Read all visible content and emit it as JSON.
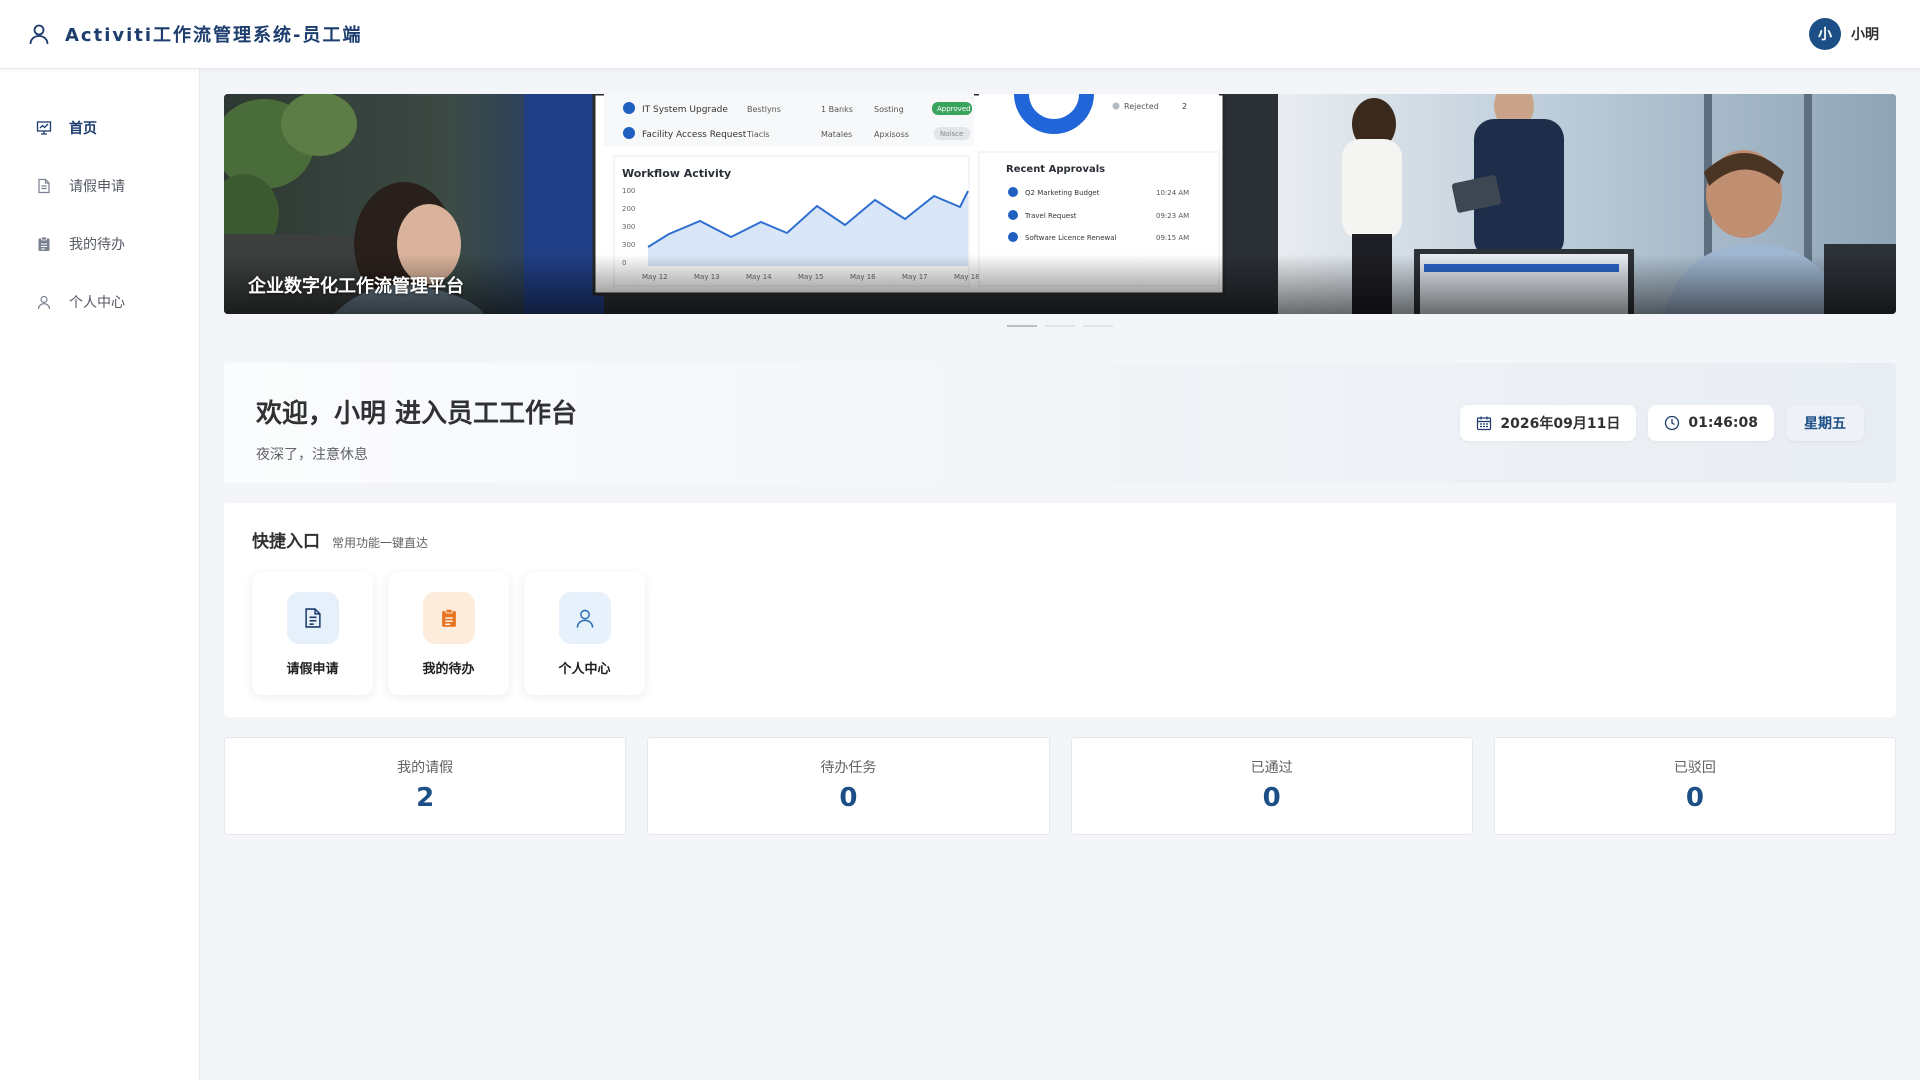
{
  "app": {
    "title": "Activiti工作流管理系统-员工端"
  },
  "user": {
    "avatar_text": "小",
    "name": "小明"
  },
  "sidebar": {
    "items": [
      {
        "label": "首页",
        "icon": "dashboard-icon",
        "active": true
      },
      {
        "label": "请假申请",
        "icon": "document-icon",
        "active": false
      },
      {
        "label": "我的待办",
        "icon": "clipboard-icon",
        "active": false
      },
      {
        "label": "个人中心",
        "icon": "user-icon",
        "active": false
      }
    ]
  },
  "banner": {
    "caption": "企业数字化工作流管理平台",
    "slide_count": 3,
    "active_slide": 1,
    "monitor": {
      "rows": [
        {
          "name": "IT System Upgrade",
          "c2": "Bestlyns",
          "c3": "1 Banks",
          "c4": "Sosting",
          "status": "Approved"
        },
        {
          "name": "Facility Access Request",
          "c2": "Tiacls",
          "c3": "Matales",
          "c4": "Apxisoss",
          "status": "Noisce"
        }
      ],
      "rejected_label": "Rejected",
      "rejected_count": "2",
      "chart_title": "Workflow Activity",
      "y_ticks": [
        "100",
        "200",
        "300",
        "300",
        "0"
      ],
      "x_ticks": [
        "May 12",
        "May 13",
        "May 14",
        "May 15",
        "May 16",
        "May 17",
        "May 18"
      ],
      "approvals_title": "Recent Approvals",
      "approvals": [
        {
          "name": "Q2 Marketing Budget",
          "time": "10:24 AM"
        },
        {
          "name": "Travel Request",
          "time": "09:23 AM"
        },
        {
          "name": "Software Licence Renewal",
          "time": "09:15 AM"
        }
      ]
    }
  },
  "welcome": {
    "title": "欢迎，小明 进入员工工作台",
    "subtitle": "夜深了，注意休息",
    "date": "2026年09月11日",
    "time": "01:46:08",
    "weekday": "星期五"
  },
  "quick": {
    "title": "快捷入口",
    "subtitle": "常用功能一键直达",
    "items": [
      {
        "label": "请假申请",
        "icon": "document-icon"
      },
      {
        "label": "我的待办",
        "icon": "clipboard-icon"
      },
      {
        "label": "个人中心",
        "icon": "user-icon"
      }
    ]
  },
  "stats": [
    {
      "label": "我的请假",
      "value": "2"
    },
    {
      "label": "待办任务",
      "value": "0"
    },
    {
      "label": "已通过",
      "value": "0"
    },
    {
      "label": "已驳回",
      "value": "0"
    }
  ],
  "colors": {
    "primary": "#1c4f86",
    "title": "#1c3d6e",
    "orange": "#e8731f",
    "background": "#f3f5f8"
  }
}
